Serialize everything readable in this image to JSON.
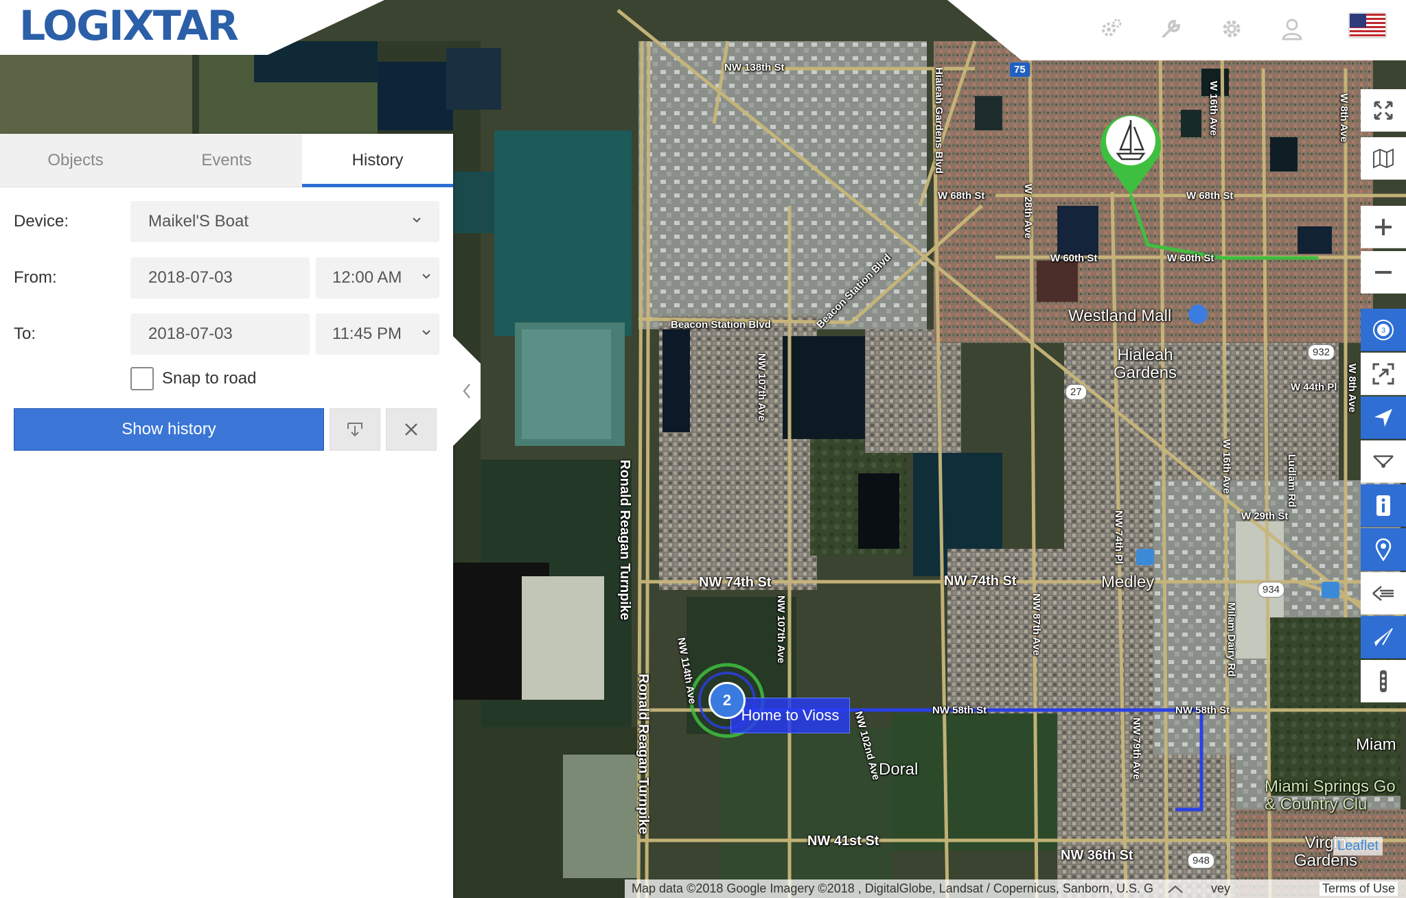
{
  "header": {
    "logo_text": "LOGIXTAR",
    "icons": [
      "cogs-icon",
      "wrench-icon",
      "gear-icon",
      "user-icon"
    ],
    "flag": "us-flag-icon"
  },
  "tabs": [
    {
      "label": "Objects",
      "active": false
    },
    {
      "label": "Events",
      "active": false
    },
    {
      "label": "History",
      "active": true
    }
  ],
  "form": {
    "device_label": "Device:",
    "device_value": "Maikel'S Boat",
    "from_label": "From:",
    "from_date": "2018-07-03",
    "from_time": "12:00 AM",
    "to_label": "To:",
    "to_date": "2018-07-03",
    "to_time": "11:45 PM",
    "snap_label": "Snap to road",
    "snap_checked": false,
    "show_history_label": "Show history"
  },
  "map": {
    "labels": {
      "nw138": "NW 138th St",
      "w68a": "W 68th St",
      "w68b": "W 68th St",
      "w60a": "W 60th St",
      "w60b": "W 60th St",
      "beacon_blvd": "Beacon Station Blvd",
      "beacon_blvd2": "Beacon Station Blvd",
      "westland": "Westland Mall",
      "hialeah": "Hialeah\nGardens",
      "w44": "W 44th Pl",
      "w29": "W 29th St",
      "nw74a": "NW 74th St",
      "nw74b": "NW 74th St",
      "medley": "Medley",
      "nw58a": "NW 58th St",
      "nw58b": "NW 58th St",
      "doral": "Doral",
      "nw41": "NW 41st St",
      "nw36": "NW 36th St",
      "miami": "Miam",
      "springs": "Miami Springs Go\n& Country Clu",
      "virginia": "Virgin\nGardens",
      "reagan1": "Ronald Reagan Turnpike",
      "reagan2": "Ronald Reagan Turnpike",
      "nw107a": "NW 107th Ave",
      "nw107b": "NW 107th Ave",
      "nw114": "NW 114th Ave",
      "nw102": "NW 102nd Ave",
      "nw87": "NW 87th Ave",
      "nw79": "NW 79th Ave",
      "nw74ct": "NW 74th Pl",
      "hialeah_blvd": "Hialeah Gardens Blvd",
      "w28": "W 28th Ave",
      "w16a": "W 16th Ave",
      "w16b": "W 16th Ave",
      "w8a": "W 8th Ave",
      "w8b": "W 8th Ave",
      "ludlam": "Ludlam Rd",
      "milam": "Milam Dairy Rd"
    },
    "shields": {
      "i75": "75",
      "r932": "932",
      "r27": "27",
      "r934": "934",
      "r948": "948"
    },
    "route_label": "Home to Vioss",
    "cluster_count": "2",
    "leaflet": "Leaflet",
    "attribution": "Map data ©2018 Google Imagery ©2018 , DigitalGlobe, Landsat / Copernicus, Sanborn, U.S. G",
    "attribution_tail": "vey",
    "terms": "Terms of Use"
  },
  "toolbar": [
    "fullscreen-icon",
    "map-layers-icon",
    "zoom-in-icon",
    "zoom-out-icon",
    "clustering-icon",
    "fit-bounds-icon",
    "follow-icon",
    "route-icon",
    "info-icon",
    "marker-icon",
    "events-icon",
    "send-icon",
    "more-icon"
  ],
  "colors": {
    "accent": "#3b76d6",
    "route_green": "#3fbf3f",
    "route_blue": "#2a40e8",
    "toolbar_blue": "#2f6fd4"
  }
}
